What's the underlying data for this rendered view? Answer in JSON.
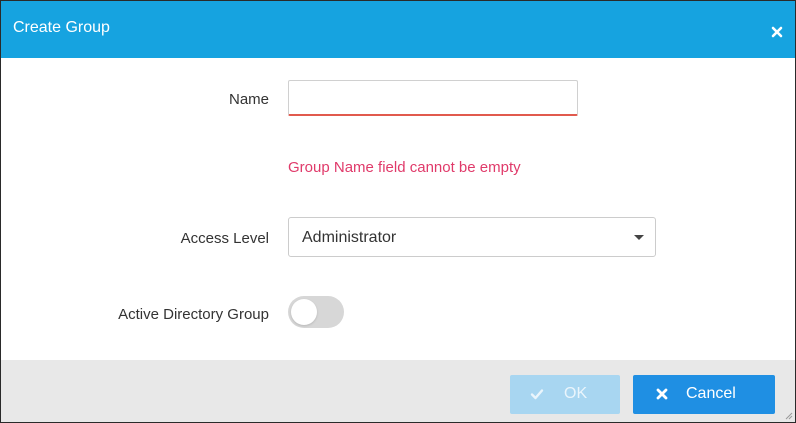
{
  "dialog": {
    "title": "Create Group",
    "close_icon": "close-icon"
  },
  "form": {
    "name": {
      "label": "Name",
      "value": "",
      "placeholder": "",
      "error": "Group Name field cannot be empty"
    },
    "access_level": {
      "label": "Access Level",
      "selected": "Administrator"
    },
    "active_directory": {
      "label": "Active Directory Group",
      "enabled": false
    }
  },
  "footer": {
    "ok_label": "OK",
    "ok_icon": "check-icon",
    "cancel_label": "Cancel",
    "cancel_icon": "x-icon"
  },
  "colors": {
    "header": "#16a3e0",
    "error": "#e03a6a",
    "cancel_button": "#1f8fe3",
    "ok_button_disabled": "#a8d6f1",
    "footer": "#e8e8e8"
  }
}
